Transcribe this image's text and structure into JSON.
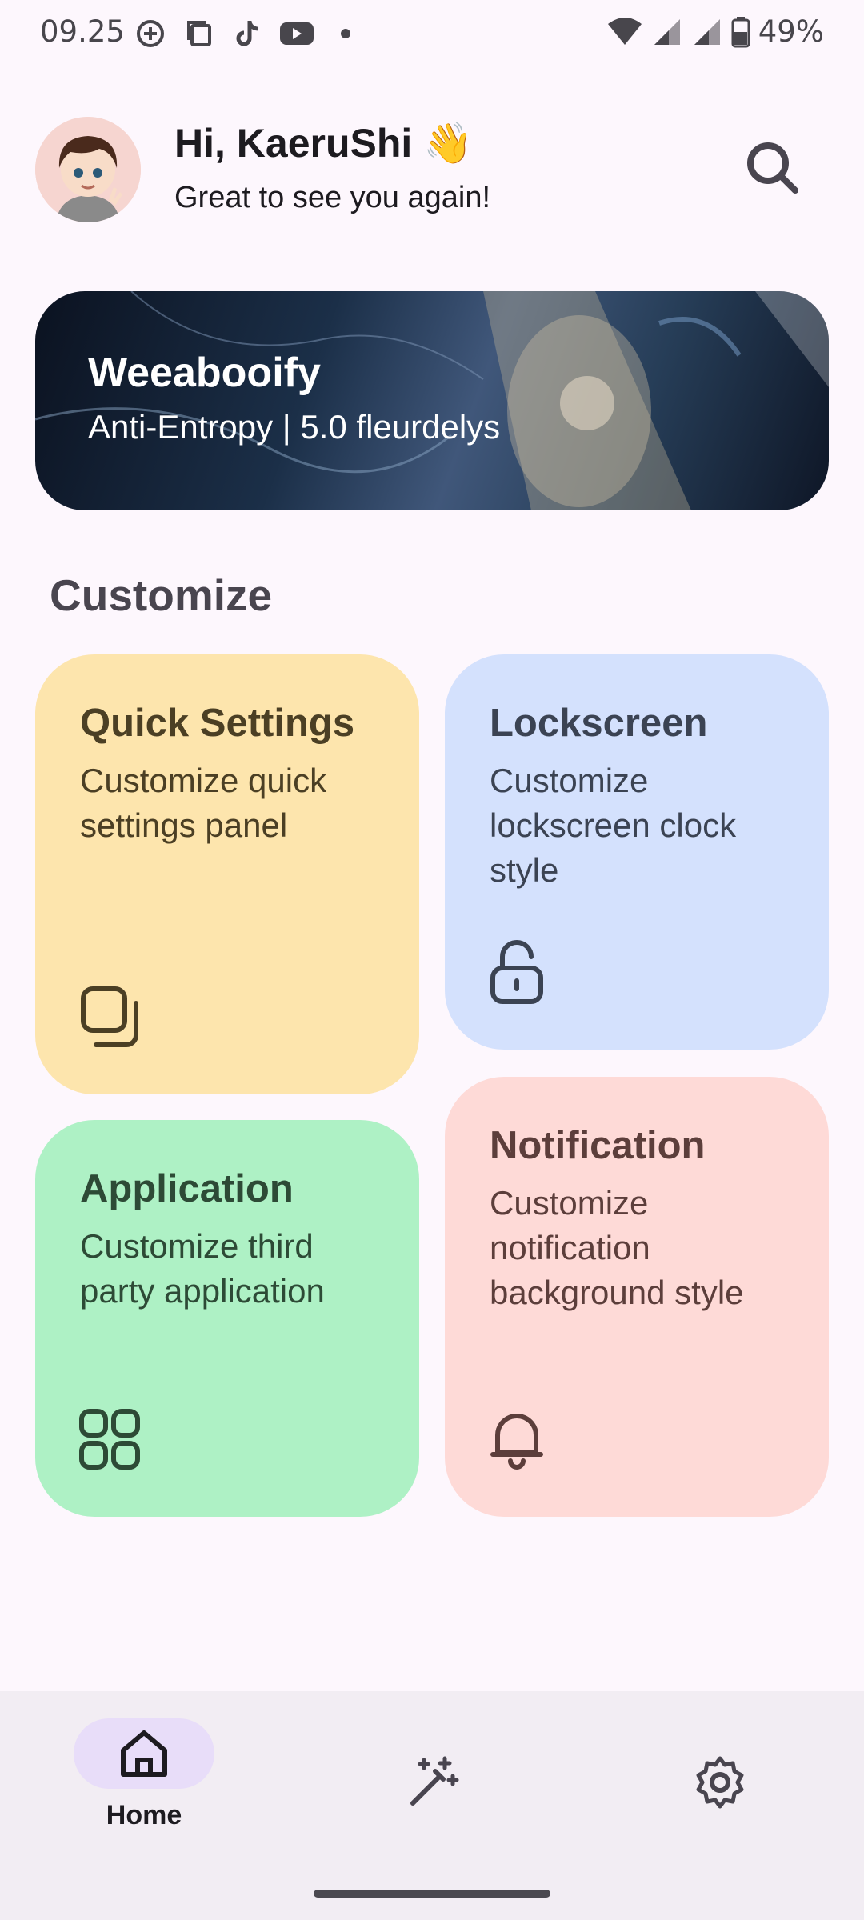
{
  "status_bar": {
    "time": "09.25",
    "battery": "49%",
    "icons": [
      "plus-circle-icon",
      "copy-icon",
      "tiktok-icon",
      "youtube-icon",
      "dot-icon",
      "wifi-icon",
      "signal-icon",
      "signal-icon",
      "battery-icon"
    ]
  },
  "header": {
    "greeting": "Hi, KaeruShi 👋",
    "subtitle": "Great to see you again!",
    "avatar_icon": "avatar",
    "search_icon": "search-icon"
  },
  "banner": {
    "title": "Weeaboоify",
    "subtitle": "Anti-Entropy | 5.0 fleurdelys"
  },
  "section": {
    "title": "Customize"
  },
  "cards": [
    {
      "title": "Quick Settings",
      "desc": "Customize quick settings panel",
      "icon": "quick-settings-icon",
      "color": "#fde5ad"
    },
    {
      "title": "Lockscreen",
      "desc": "Customize lockscreen clock style",
      "icon": "unlock-icon",
      "color": "#d4e1fd"
    },
    {
      "title": "Application",
      "desc": "Customize third party application",
      "icon": "grid-icon",
      "color": "#aef1c5"
    },
    {
      "title": "Notification",
      "desc": "Customize notification background style",
      "icon": "bell-icon",
      "color": "#fedad7"
    }
  ],
  "bottom_nav": {
    "home_label": "Home",
    "items": [
      "home-icon",
      "magic-wand-icon",
      "gear-icon"
    ]
  }
}
